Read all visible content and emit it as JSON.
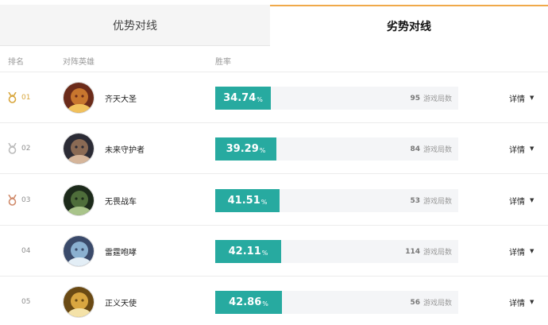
{
  "tabs": {
    "advantage": "优势对线",
    "disadvantage": "劣势对线"
  },
  "header": {
    "rank": "排名",
    "hero": "对阵英雄",
    "winrate": "胜率"
  },
  "units": {
    "percent": "%",
    "games_suffix": "游戏局数"
  },
  "detail_label": "详情",
  "colors": {
    "bar": "#27aaa0",
    "gold": "#d8a63c",
    "silver": "#bbbbbb",
    "bronze": "#d08a6a",
    "active_tab_line": "#f0a94a"
  },
  "rows": [
    {
      "rank": "01",
      "medal": "gold-medal-icon",
      "hero": "齐天大圣",
      "winrate": "34.74",
      "winrate_fraction": 0.3474,
      "games": "95"
    },
    {
      "rank": "02",
      "medal": "silver-medal-icon",
      "hero": "未来守护者",
      "winrate": "39.29",
      "winrate_fraction": 0.3929,
      "games": "84"
    },
    {
      "rank": "03",
      "medal": "bronze-medal-icon",
      "hero": "无畏战车",
      "winrate": "41.51",
      "winrate_fraction": 0.4151,
      "games": "53"
    },
    {
      "rank": "04",
      "medal": "",
      "hero": "雷霆咆哮",
      "winrate": "42.11",
      "winrate_fraction": 0.4211,
      "games": "114"
    },
    {
      "rank": "05",
      "medal": "",
      "hero": "正义天使",
      "winrate": "42.86",
      "winrate_fraction": 0.4286,
      "games": "56"
    }
  ]
}
